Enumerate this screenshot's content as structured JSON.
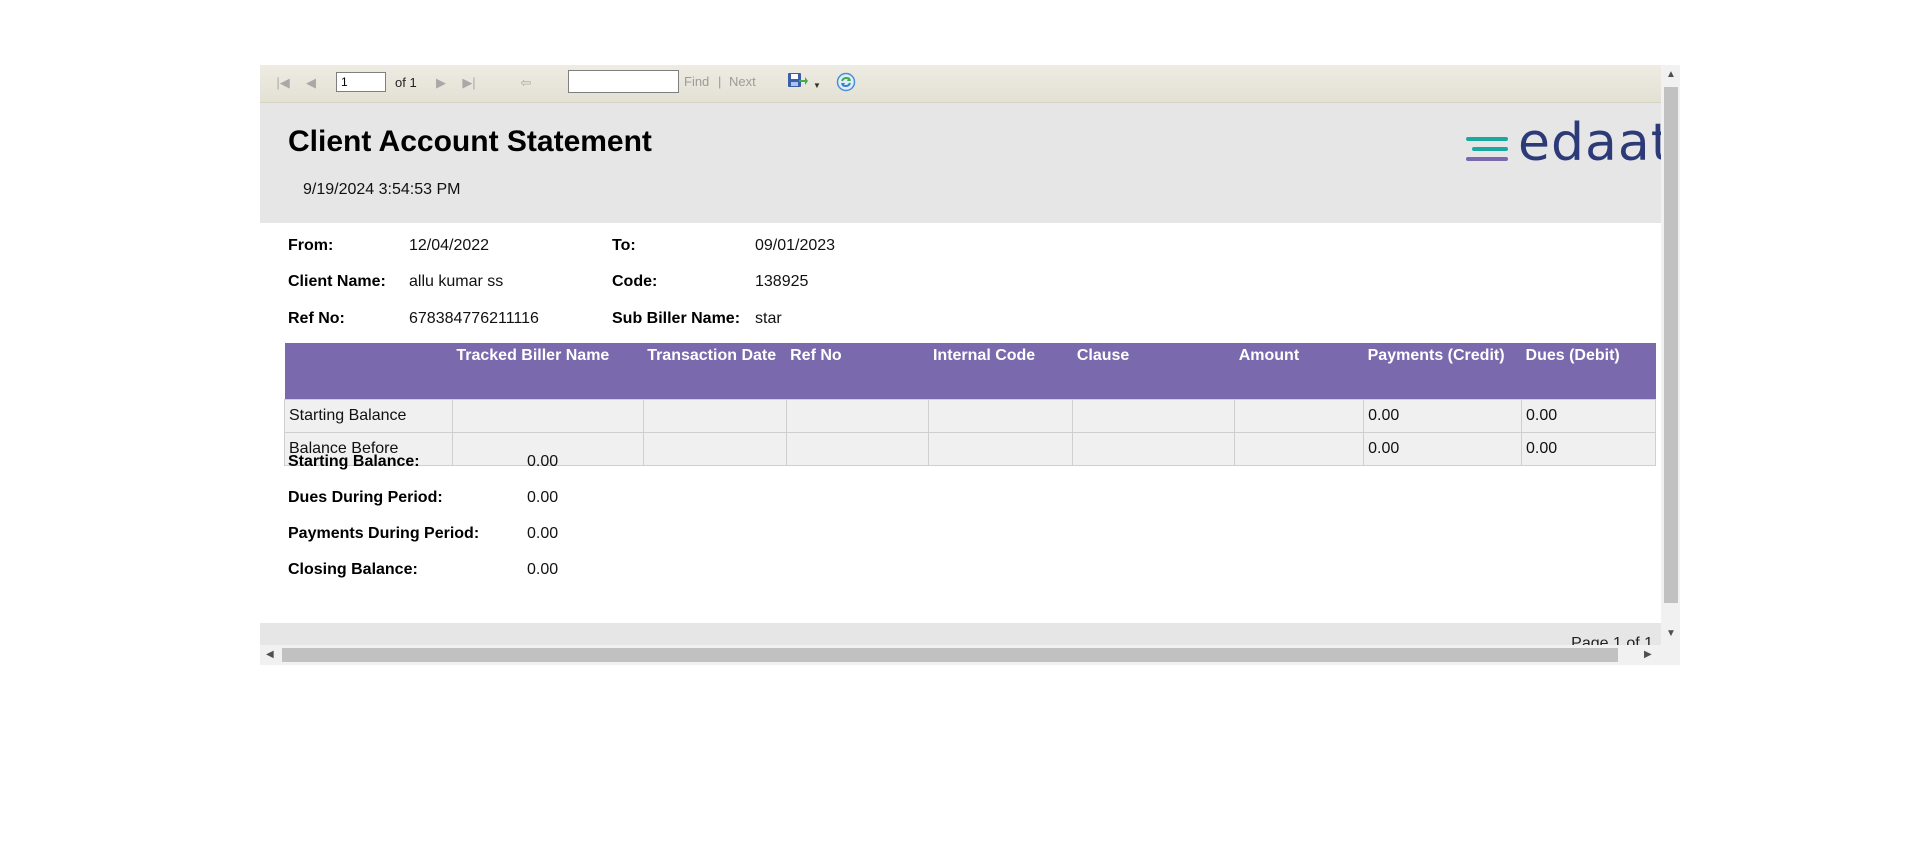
{
  "toolbar": {
    "page_value": "1",
    "of_label": "of 1",
    "find_placeholder": "",
    "find_label": "Find",
    "separator": "|",
    "next_label": "Next"
  },
  "report": {
    "title": "Client Account Statement",
    "timestamp": "9/19/2024 3:54:53 PM",
    "logo_text": "edaat",
    "info": {
      "from_label": "From:",
      "from_value": "12/04/2022",
      "to_label": "To:",
      "to_value": "09/01/2023",
      "client_label": "Client Name:",
      "client_value": "allu kumar ss",
      "code_label": "Code:",
      "code_value": "138925",
      "ref_label": "Ref No:",
      "ref_value": "678384776211116",
      "subbiller_label": "Sub Biller Name:",
      "subbiller_value": "star"
    },
    "table": {
      "headers": [
        "",
        "Tracked Biller Name",
        "Transaction Date",
        "Ref No",
        "Internal Code",
        "Clause",
        "Amount",
        "Payments (Credit)",
        "Dues (Debit)"
      ],
      "rows": [
        [
          "Starting Balance",
          "",
          "",
          "",
          "",
          "",
          "",
          "0.00",
          "0.00"
        ],
        [
          "Balance Before",
          "",
          "",
          "",
          "",
          "",
          "",
          "0.00",
          "0.00"
        ]
      ]
    },
    "summary": {
      "starting_label": "Starting Balance:",
      "starting_value": "0.00",
      "dues_label": "Dues During Period:",
      "dues_value": "0.00",
      "payments_label": "Payments During Period:",
      "payments_value": "0.00",
      "closing_label": "Closing Balance:",
      "closing_value": "0.00"
    },
    "page_indicator": "Page 1 of 1"
  },
  "colors": {
    "header_purple": "#7a69ad",
    "logo_navy": "#2d3a78",
    "logo_teal": "#1aa99e",
    "logo_purple": "#7a69ad"
  }
}
